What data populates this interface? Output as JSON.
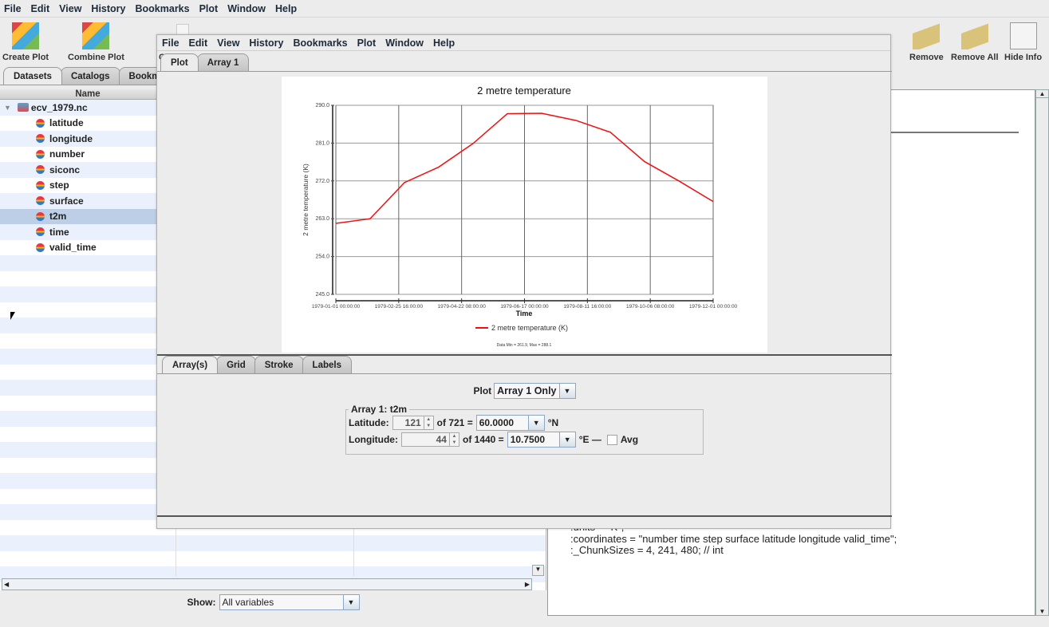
{
  "menubar": [
    "File",
    "Edit",
    "View",
    "History",
    "Bookmarks",
    "Plot",
    "Window",
    "Help"
  ],
  "toolbar": {
    "left": [
      {
        "label": "Create Plot",
        "icon": "create-plot-icon"
      },
      {
        "label": "Combine Plot",
        "icon": "combine-plot-icon"
      },
      {
        "label": "C",
        "icon": "truncated-tool-icon"
      }
    ],
    "right": [
      {
        "label": "Remove",
        "icon": "broom-icon"
      },
      {
        "label": "Remove All",
        "icon": "brooms-icon"
      },
      {
        "label": "Hide Info",
        "icon": "info-window-icon"
      }
    ]
  },
  "left_tabs": [
    "Datasets",
    "Catalogs",
    "Bookm"
  ],
  "tree": {
    "column_header": "Name",
    "root": "ecv_1979.nc",
    "items": [
      "latitude",
      "longitude",
      "number",
      "siconc",
      "step",
      "surface",
      "t2m",
      "time",
      "valid_time"
    ],
    "selected": "t2m"
  },
  "show": {
    "label": "Show:",
    "value": "All variables"
  },
  "info_text": [
    ":units = \"K\";",
    ":coordinates = \"number time step surface latitude longitude valid_time\";",
    ":_ChunkSizes = 4, 241, 480; // int"
  ],
  "plot_window": {
    "menubar": [
      "File",
      "Edit",
      "View",
      "History",
      "Bookmarks",
      "Plot",
      "Window",
      "Help"
    ],
    "tabs": [
      "Plot",
      "Array 1"
    ],
    "bottom_tabs": [
      "Array(s)",
      "Grid",
      "Stroke",
      "Labels"
    ],
    "plot_label": "Plot",
    "plot_select": "Array 1 Only",
    "array_group": "Array 1: t2m",
    "latitude": {
      "label": "Latitude:",
      "index": "121",
      "of": "of 721 =",
      "value": "60.0000",
      "unit": "°N"
    },
    "longitude": {
      "label": "Longitude:",
      "index": "44",
      "of": "of 1440 =",
      "value": "10.7500",
      "unit": "°E —",
      "avg_label": "Avg",
      "avg_checked": false
    }
  },
  "chart_data": {
    "type": "line",
    "title": "2 metre temperature",
    "xlabel": "Time",
    "ylabel": "2 metre temperature (K)",
    "x_ticks": [
      "1979-01-01 00:00:00",
      "1979-02-25 16:00:00",
      "1979-04-22 08:00:00",
      "1979-06-17 00:00:00",
      "1979-08-11 16:00:00",
      "1979-10-06 08:00:00",
      "1979-12-01 00:00:00"
    ],
    "y_ticks": [
      "245.0",
      "254.0",
      "263.0",
      "272.0",
      "281.0",
      "290.0"
    ],
    "ylim": [
      245,
      290
    ],
    "x": [
      "1979-01",
      "1979-02",
      "1979-03",
      "1979-04",
      "1979-05",
      "1979-06",
      "1979-07",
      "1979-08",
      "1979-09",
      "1979-10",
      "1979-11",
      "1979-12"
    ],
    "series": [
      {
        "name": "2 metre temperature (K)",
        "color": "#ee1111",
        "values": [
          261.9,
          263.0,
          271.6,
          275.3,
          280.9,
          288.0,
          288.1,
          286.4,
          283.6,
          276.6,
          272.0,
          267.1
        ]
      }
    ],
    "legend": "bottom",
    "footer": "Data Min = 261.9, Max = 288.1",
    "grid": true
  }
}
